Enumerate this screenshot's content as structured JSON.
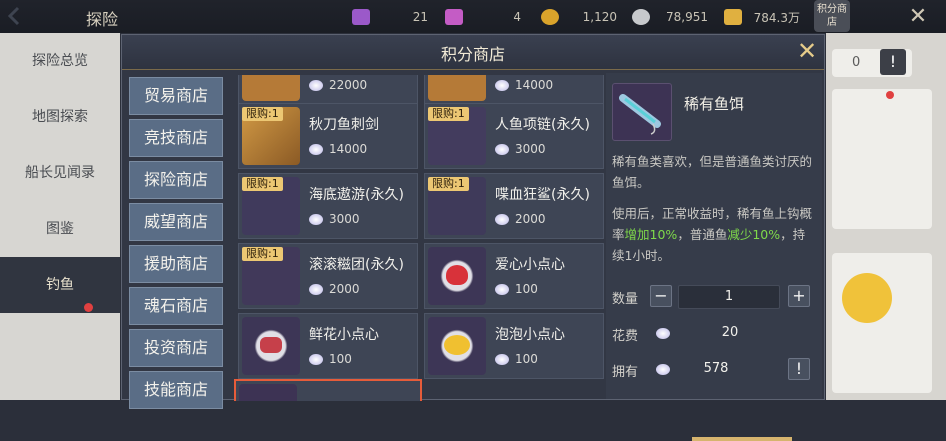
{
  "topbar": {
    "title": "探险",
    "resources": [
      {
        "icon": "purple-gem-icon",
        "value": "21",
        "color": "#9b59c9"
      },
      {
        "icon": "pink-gem-icon",
        "value": "4",
        "color": "#c45cc5"
      },
      {
        "icon": "gold-coin-icon",
        "value": "1,120",
        "color": "#d9a32b"
      },
      {
        "icon": "silver-coin-icon",
        "value": "78,951",
        "color": "#c7c9cc"
      },
      {
        "icon": "gold-ingot-icon",
        "value": "784.3万",
        "color": "#e0b040"
      }
    ],
    "shop_label": "积分商店"
  },
  "leftnav": {
    "items": [
      "探险总览",
      "地图探索",
      "船长见闻录",
      "图鉴",
      "钓鱼"
    ]
  },
  "modal": {
    "title": "积分商店",
    "tabs": [
      "贸易商店",
      "竞技商店",
      "探险商店",
      "威望商店",
      "援助商店",
      "魂石商店",
      "投资商店",
      "技能商店"
    ],
    "partial_prices": [
      "22000",
      "14000"
    ],
    "items": [
      {
        "name": "秋刀鱼刺剑",
        "price": "14000",
        "limit": "限购:1"
      },
      {
        "name": "人鱼项链(永久)",
        "price": "3000",
        "limit": "限购:1"
      },
      {
        "name": "海底遨游(永久)",
        "price": "3000",
        "limit": "限购:1"
      },
      {
        "name": "喋血狂鲨(永久)",
        "price": "2000",
        "limit": "限购:1"
      },
      {
        "name": "滚滚糍团(永久)",
        "price": "2000",
        "limit": "限购:1"
      },
      {
        "name": "爱心小点心",
        "price": "100",
        "limit": ""
      },
      {
        "name": "鲜花小点心",
        "price": "100",
        "limit": ""
      },
      {
        "name": "泡泡小点心",
        "price": "100",
        "limit": ""
      }
    ],
    "detail": {
      "name": "稀有鱼饵",
      "desc1": "稀有鱼类喜欢，但是普通鱼类讨厌的鱼饵。",
      "desc2a": "使用后，正常收益时，稀有鱼上钩概率",
      "desc2b": "增加10%",
      "desc2c": "，普通鱼",
      "desc2d": "减少10%",
      "desc2e": "，持续1小时。",
      "qty_label": "数量",
      "qty": "1",
      "cost_label": "花费",
      "cost": "20",
      "own_label": "拥有",
      "own": "578"
    },
    "right_bg_value": "0"
  }
}
